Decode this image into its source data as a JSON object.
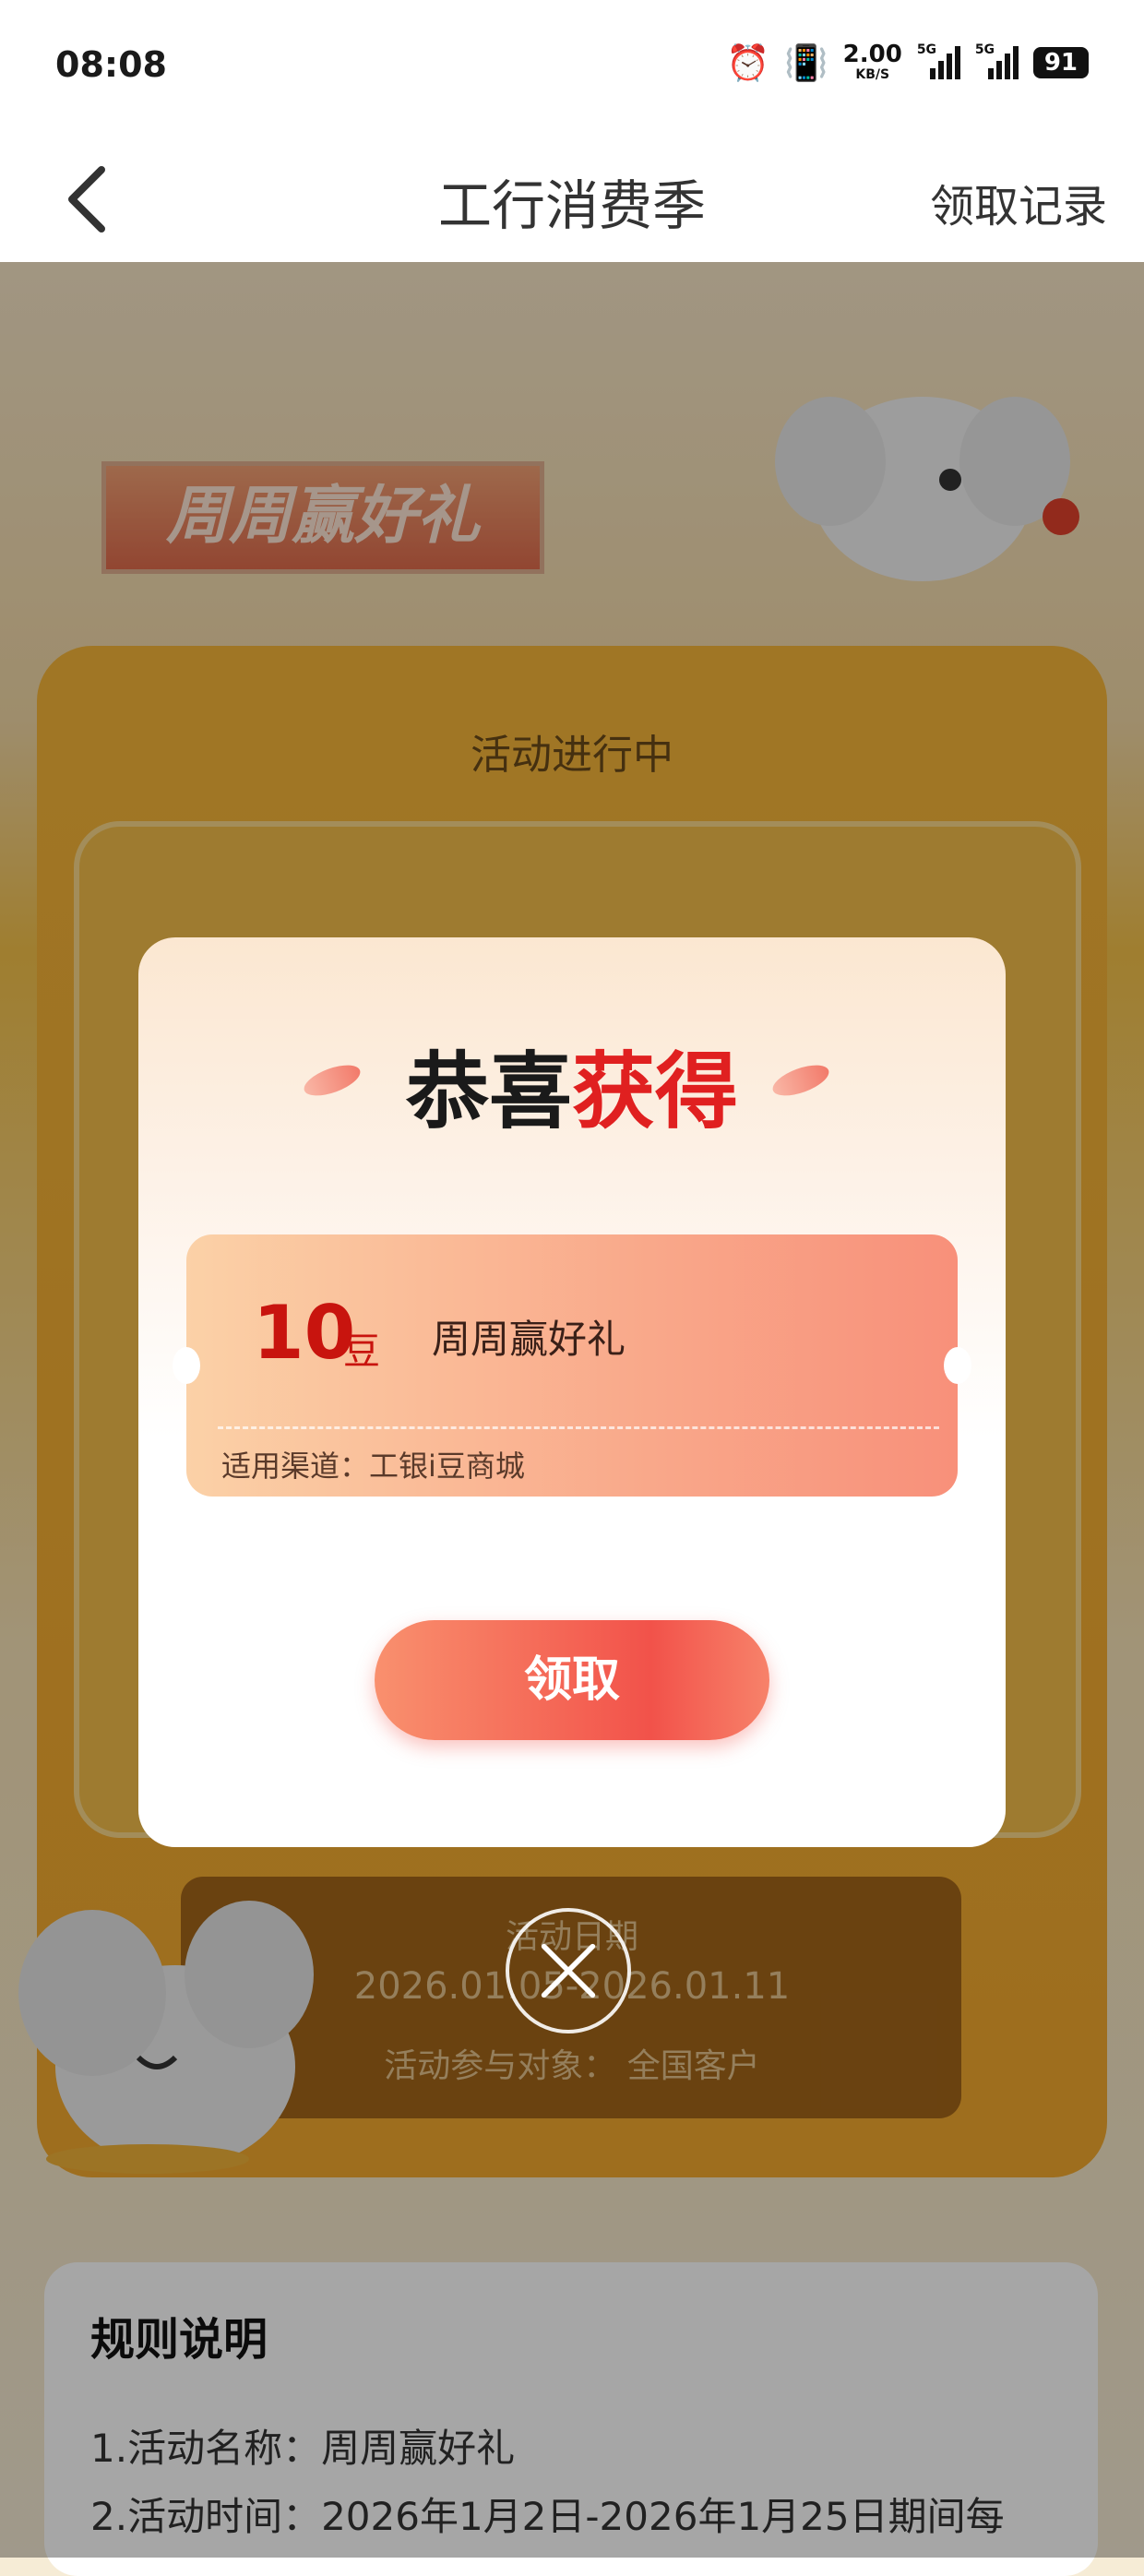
{
  "status_bar": {
    "time": "08:08",
    "net_speed_value": "2.00",
    "net_speed_unit": "KB/S",
    "signal1_label": "5G",
    "signal2_label": "5G",
    "battery": "91",
    "icons": [
      "alarm-icon",
      "vibrate-icon",
      "signal-icon",
      "battery-icon"
    ]
  },
  "nav": {
    "title": "工行消费季",
    "right_link": "领取记录",
    "back_icon": "chevron-left-icon"
  },
  "banner": {
    "label": "周周赢好礼"
  },
  "activity": {
    "status": "活动进行中",
    "date_title": "活动日期",
    "date_range": "2026.01.05-2026.01.11",
    "audience": "活动参与对象：  全国客户"
  },
  "rules": {
    "title": "规则说明",
    "lines": [
      "1.活动名称：周周赢好礼",
      "2.活动时间：2026年1月2日-2026年1月25日期间每"
    ]
  },
  "modal": {
    "title_part1": "恭喜",
    "title_part2": "获得",
    "coupon": {
      "amount": "10",
      "unit": "豆",
      "name": "周周赢好礼",
      "channel": "适用渠道：工银i豆商城"
    },
    "claim_button": "领取",
    "close_icon": "close-icon"
  },
  "colors": {
    "accent_red": "#e02020",
    "button_red": "#f2524a",
    "machine_yellow": "#f6b63a"
  }
}
